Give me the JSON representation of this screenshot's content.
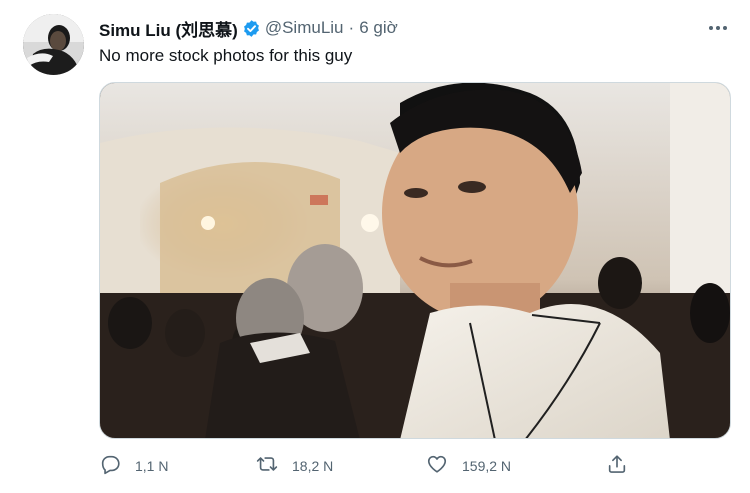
{
  "author": {
    "display_name": "Simu Liu (刘思慕)",
    "handle": "@SimuLiu",
    "separator": "·",
    "time": "6 giờ",
    "verified": true
  },
  "tweet": {
    "text": "No more stock photos for this guy"
  },
  "actions": {
    "reply_count": "1,1 N",
    "retweet_count": "18,2 N",
    "like_count": "159,2 N"
  },
  "colors": {
    "verified_blue": "#1d9bf0",
    "muted_text": "#536471",
    "primary_text": "#0f1419"
  },
  "icons": [
    "more-horizontal-icon",
    "verified-badge-icon",
    "reply-icon",
    "retweet-icon",
    "like-icon",
    "share-icon"
  ]
}
